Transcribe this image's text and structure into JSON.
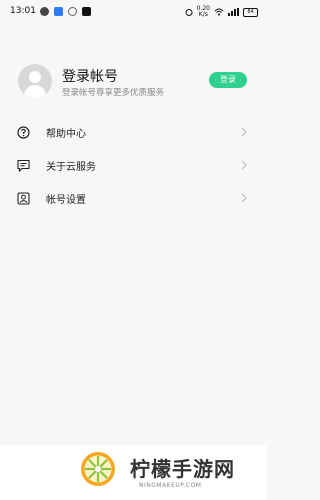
{
  "status_bar": {
    "time": "13:01",
    "net_speed_value": "0.20",
    "net_speed_unit": "K/s",
    "battery": "84"
  },
  "profile": {
    "title": "登录帐号",
    "subtitle": "登录帐号尊享更多优质服务",
    "login_button": "登录"
  },
  "menu": {
    "items": [
      {
        "label": "帮助中心",
        "icon": "help-circle-icon"
      },
      {
        "label": "关于云服务",
        "icon": "message-square-icon"
      },
      {
        "label": "帐号设置",
        "icon": "account-card-icon"
      }
    ]
  },
  "watermark": {
    "title": "柠檬手游网",
    "subtitle": "NINGMAKEUP.COM"
  },
  "colors": {
    "accent": "#2fcf8d",
    "background": "#f7f7f7"
  }
}
